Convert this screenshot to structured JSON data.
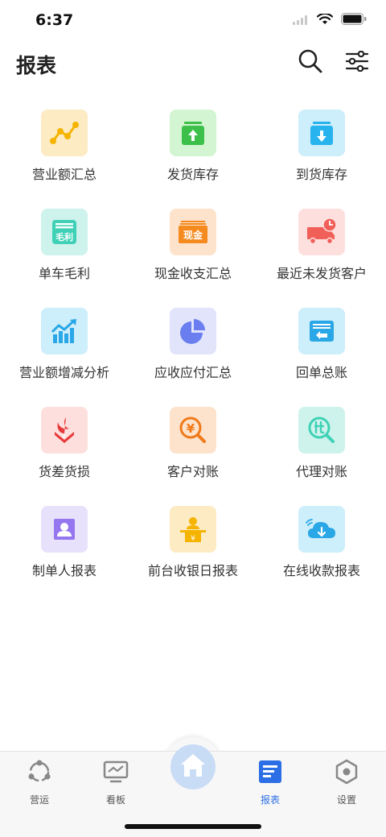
{
  "status": {
    "time": "6:37"
  },
  "header": {
    "title": "报表"
  },
  "grid": [
    {
      "label": "营业额汇总",
      "icon": "line-chart-icon",
      "bg": "#fdebc4",
      "fg": "#f5b400"
    },
    {
      "label": "发货库存",
      "icon": "box-up-icon",
      "bg": "#d4f5d2",
      "fg": "#3cc04a"
    },
    {
      "label": "到货库存",
      "icon": "box-down-icon",
      "bg": "#cdeefb",
      "fg": "#27b3ee"
    },
    {
      "label": "单车毛利",
      "icon": "gross-profit-icon",
      "bg": "#cdf3ec",
      "fg": "#3fd1b6",
      "text": "毛利"
    },
    {
      "label": "现金收支汇总",
      "icon": "cash-icon",
      "bg": "#fde2cc",
      "fg": "#f58a1f",
      "text": "现金"
    },
    {
      "label": "最近未发货客户",
      "icon": "truck-clock-icon",
      "bg": "#fde0de",
      "fg": "#f06058"
    },
    {
      "label": "营业额增减分析",
      "icon": "growth-chart-icon",
      "bg": "#cdeefb",
      "fg": "#2aa7e6"
    },
    {
      "label": "应收应付汇总",
      "icon": "pie-chart-icon",
      "bg": "#e1e4fb",
      "fg": "#6a7ef0"
    },
    {
      "label": "回单总账",
      "icon": "receipt-return-icon",
      "bg": "#cdeefb",
      "fg": "#2aa7e6"
    },
    {
      "label": "货差货损",
      "icon": "damage-arrow-icon",
      "bg": "#fde0de",
      "fg": "#e83a3a"
    },
    {
      "label": "客户对账",
      "icon": "yen-search-icon",
      "bg": "#fde2cc",
      "fg": "#f07a1a"
    },
    {
      "label": "代理对账",
      "icon": "agent-search-icon",
      "bg": "#cdf3ec",
      "fg": "#3fd1b6"
    },
    {
      "label": "制单人报表",
      "icon": "user-card-icon",
      "bg": "#e7e1fb",
      "fg": "#9477ee"
    },
    {
      "label": "前台收银日报表",
      "icon": "cashier-icon",
      "bg": "#fdebc4",
      "fg": "#f5b400"
    },
    {
      "label": "在线收款报表",
      "icon": "cloud-download-icon",
      "bg": "#cdeefb",
      "fg": "#2aa7e6"
    }
  ],
  "tabbar": {
    "items": [
      {
        "label": "营运",
        "icon": "operation-icon"
      },
      {
        "label": "看板",
        "icon": "dashboard-icon"
      },
      {
        "label": "",
        "icon": "home-icon"
      },
      {
        "label": "报表",
        "icon": "report-icon",
        "active": true
      },
      {
        "label": "设置",
        "icon": "settings-icon"
      }
    ],
    "active_color": "#2b6ee6"
  }
}
